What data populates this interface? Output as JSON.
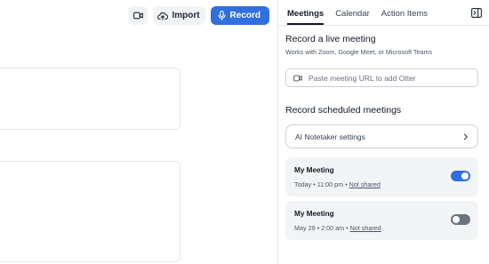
{
  "toolbar": {
    "video_icon": "video-camera-icon",
    "import_label": "Import",
    "import_icon": "cloud-upload-icon",
    "record_label": "Record",
    "record_icon": "microphone-icon",
    "record_color": "#2f6fe0"
  },
  "panel": {
    "tabs": [
      {
        "label": "Meetings",
        "active": true
      },
      {
        "label": "Calendar",
        "active": false
      },
      {
        "label": "Action Items",
        "active": false
      }
    ],
    "collapse_icon": "panel-collapse-icon",
    "live": {
      "heading": "Record a live meeting",
      "subtitle": "Works with Zoom, Google Meet, or Microsoft Teams",
      "url_placeholder": "Paste meeting URL to add Otter"
    },
    "scheduled": {
      "heading": "Record scheduled meetings",
      "settings_label": "AI Notetaker settings"
    },
    "meetings": [
      {
        "title": "My Meeting",
        "date": "Today",
        "time": "11:00 pm",
        "share": "Not shared",
        "recording_enabled": true
      },
      {
        "title": "My Meeting",
        "date": "May 29",
        "time": "2:00 am",
        "share": "Not shared",
        "recording_enabled": false
      }
    ]
  }
}
